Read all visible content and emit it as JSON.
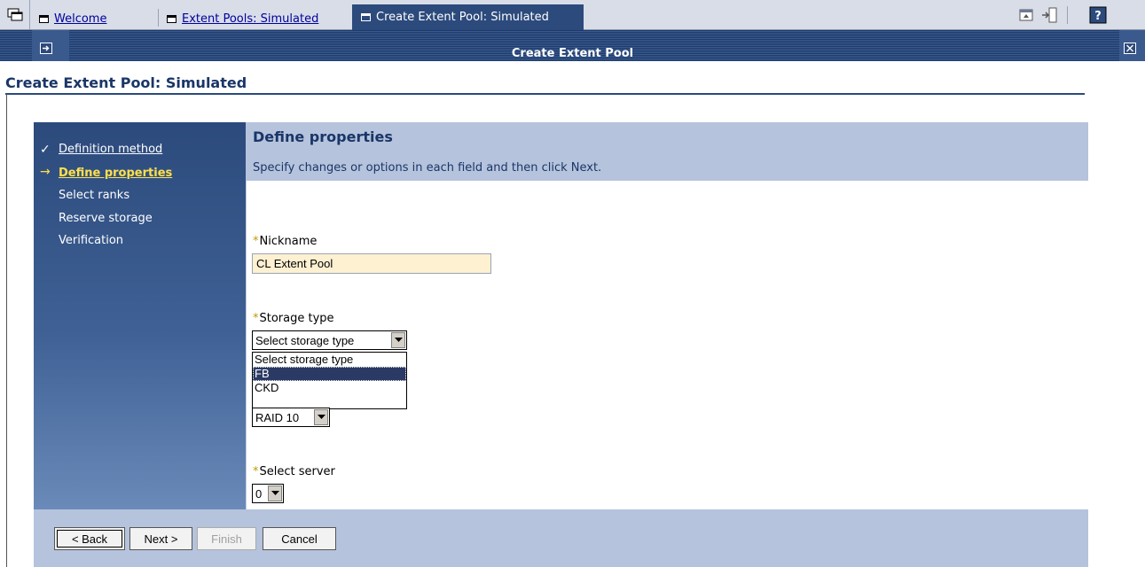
{
  "tabs": [
    {
      "label": "Welcome"
    },
    {
      "label": "Extent Pools: Simulated"
    },
    {
      "label": "Create Extent Pool: Simulated"
    }
  ],
  "strip": {
    "title": "Create Extent Pool"
  },
  "page": {
    "title": "Create Extent Pool: Simulated"
  },
  "nav": {
    "steps": [
      {
        "label": "Definition method",
        "state": "done"
      },
      {
        "label": "Define properties",
        "state": "current"
      },
      {
        "label": "Select ranks",
        "state": "pending"
      },
      {
        "label": "Reserve storage",
        "state": "pending"
      },
      {
        "label": "Verification",
        "state": "pending"
      }
    ]
  },
  "header": {
    "title": "Define properties",
    "description": "Specify changes or options in each field and then click Next."
  },
  "form": {
    "required_mark": "*",
    "nickname": {
      "label": "Nickname",
      "value": "CL Extent Pool"
    },
    "storage_type": {
      "label": "Storage type",
      "selected": "Select storage type",
      "options": [
        "Select storage type",
        "FB",
        "CKD"
      ],
      "highlighted": "FB"
    },
    "raid": {
      "selected": "RAID 10"
    },
    "server": {
      "label": "Select server",
      "selected": "0"
    }
  },
  "buttons": {
    "back": "< Back",
    "next": "Next >",
    "finish": "Finish",
    "cancel": "Cancel"
  },
  "colors": {
    "accent": "#2c4a7c",
    "header_bg": "#b5c3dc",
    "current_step": "#ffe04a",
    "field_bg": "#fdf1d2"
  }
}
